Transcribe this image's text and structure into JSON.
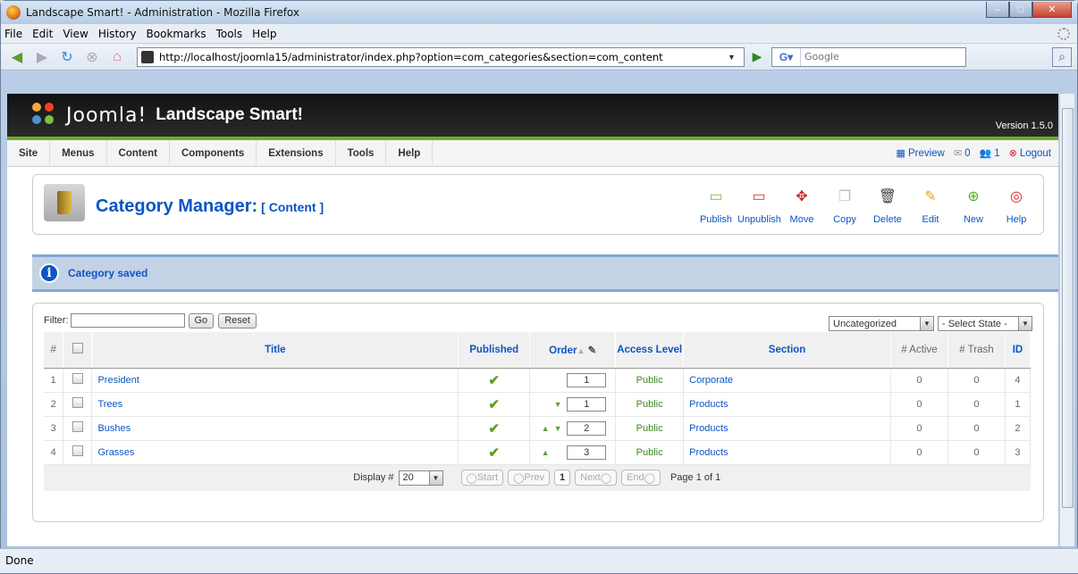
{
  "window": {
    "title": "Landscape Smart! - Administration - Mozilla Firefox"
  },
  "browser": {
    "menu": [
      "File",
      "Edit",
      "View",
      "History",
      "Bookmarks",
      "Tools",
      "Help"
    ],
    "url": "http://localhost/joomla15/administrator/index.php?option=com_categories&section=com_content",
    "search_placeholder": "Google",
    "status": "Done"
  },
  "joomla": {
    "brand": "Joomla!",
    "site_name": "Landscape Smart!",
    "version": "Version 1.5.0",
    "menu": [
      "Site",
      "Menus",
      "Content",
      "Components",
      "Extensions",
      "Tools",
      "Help"
    ],
    "right": {
      "preview": "Preview",
      "messages": "0",
      "users": "1",
      "logout": "Logout"
    }
  },
  "page": {
    "title": "Category Manager:",
    "subtitle": "[ Content ]",
    "toolbar": [
      "Publish",
      "Unpublish",
      "Move",
      "Copy",
      "Delete",
      "Edit",
      "New",
      "Help"
    ],
    "message": "Category saved"
  },
  "filter": {
    "label": "Filter:",
    "value": "",
    "go": "Go",
    "reset": "Reset",
    "section_select": "Uncategorized",
    "state_select": "- Select State -"
  },
  "table": {
    "headers": {
      "num": "#",
      "title": "Title",
      "published": "Published",
      "order": "Order",
      "access": "Access Level",
      "section": "Section",
      "active": "# Active",
      "trash": "# Trash",
      "id": "ID"
    },
    "rows": [
      {
        "num": "1",
        "title": "President",
        "order": "1",
        "access": "Public",
        "section": "Corporate",
        "active": "0",
        "trash": "0",
        "id": "4",
        "up": false,
        "down": false
      },
      {
        "num": "2",
        "title": "Trees",
        "order": "1",
        "access": "Public",
        "section": "Products",
        "active": "0",
        "trash": "0",
        "id": "1",
        "up": false,
        "down": true
      },
      {
        "num": "3",
        "title": "Bushes",
        "order": "2",
        "access": "Public",
        "section": "Products",
        "active": "0",
        "trash": "0",
        "id": "2",
        "up": true,
        "down": true
      },
      {
        "num": "4",
        "title": "Grasses",
        "order": "3",
        "access": "Public",
        "section": "Products",
        "active": "0",
        "trash": "0",
        "id": "3",
        "up": true,
        "down": false
      }
    ]
  },
  "pagination": {
    "display_label": "Display #",
    "limit": "20",
    "start": "Start",
    "prev": "Prev",
    "current": "1",
    "next": "Next",
    "end": "End",
    "summary": "Page 1 of 1"
  }
}
